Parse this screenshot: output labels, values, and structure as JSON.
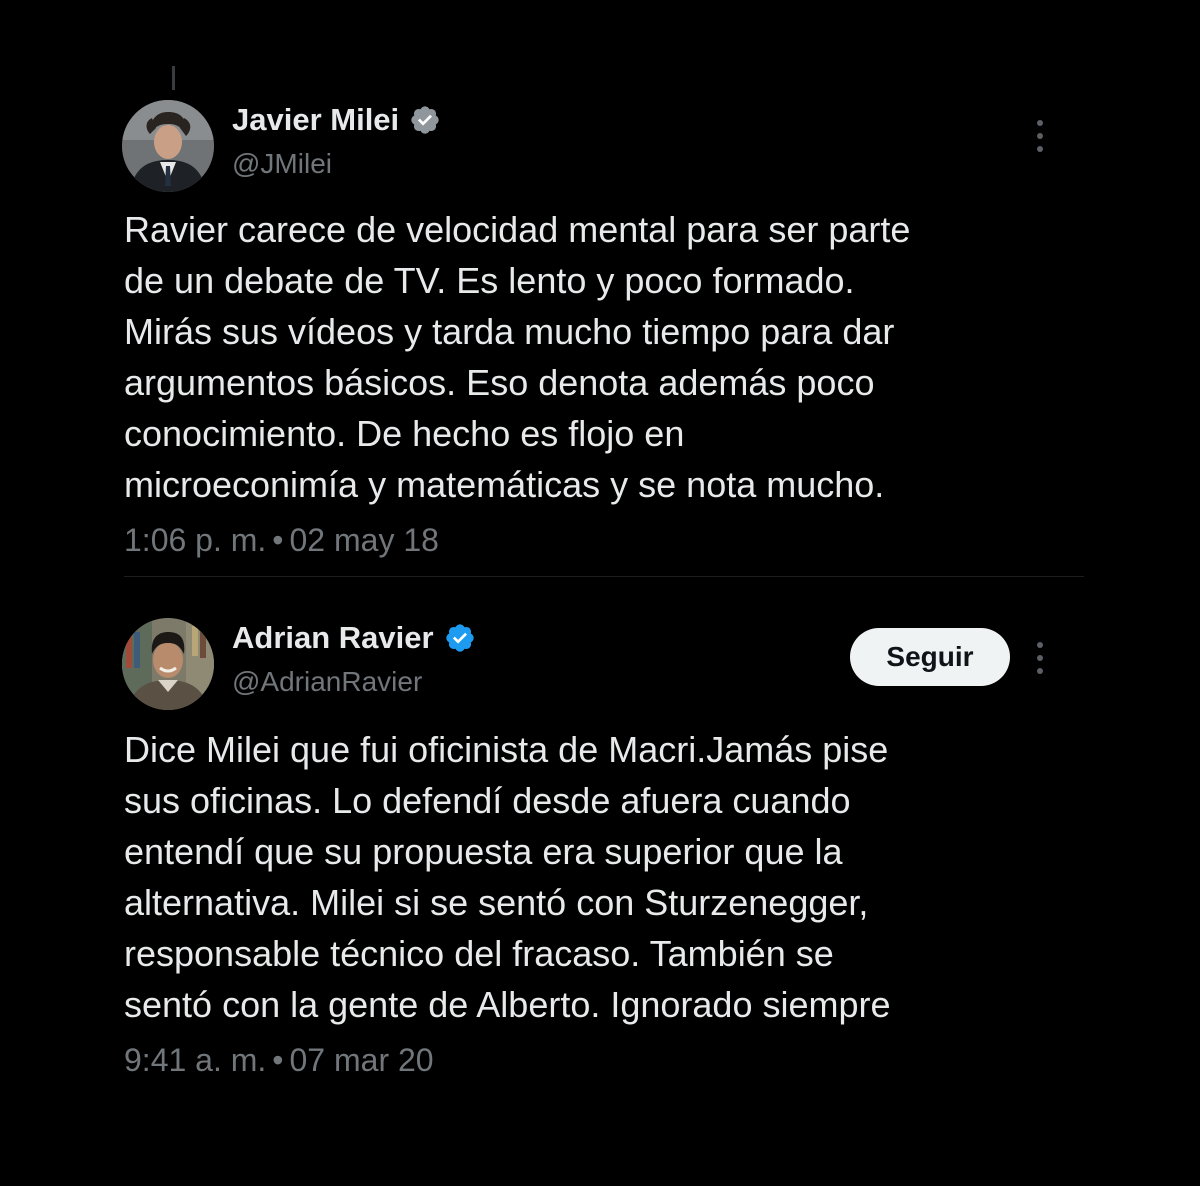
{
  "tweets": [
    {
      "display_name": "Javier Milei",
      "handle": "@JMilei",
      "verified": true,
      "show_follow": false,
      "body_lines": [
        "Ravier carece de velocidad mental para ser parte",
        "de un debate de TV. Es lento y poco formado.",
        "Mirás sus vídeos y tarda mucho tiempo para dar",
        "argumentos básicos. Eso denota además poco",
        "conocimiento. De hecho es flojo en",
        "microeconimía y matemáticas y se nota mucho."
      ],
      "time": "1:06 p. m.",
      "separator": "•",
      "date": "02 may 18"
    },
    {
      "display_name": "Adrian Ravier",
      "handle": "@AdrianRavier",
      "verified": true,
      "show_follow": true,
      "follow_label": "Seguir",
      "body_lines": [
        "Dice Milei que fui oficinista de Macri.Jamás pise",
        "sus oficinas. Lo defendí desde afuera cuando",
        "entendí que su propuesta era superior que la",
        "alternativa. Milei si se sentó con Sturzenegger,",
        "responsable técnico del fracaso. También se",
        "sentó con la gente de Alberto. Ignorado siempre"
      ],
      "time": "9:41 a. m.",
      "separator": "•",
      "date": "07 mar 20"
    }
  ],
  "colors": {
    "background": "#000000",
    "primary_text": "#e7e9ea",
    "secondary_text": "#71767b",
    "verified_milei": "#8f969c",
    "verified_ravier": "#1d9bf0",
    "follow_bg": "#eff3f4",
    "follow_text": "#0f1419"
  },
  "icons": {
    "verified": "verified-badge-icon",
    "more": "more-options-icon"
  }
}
